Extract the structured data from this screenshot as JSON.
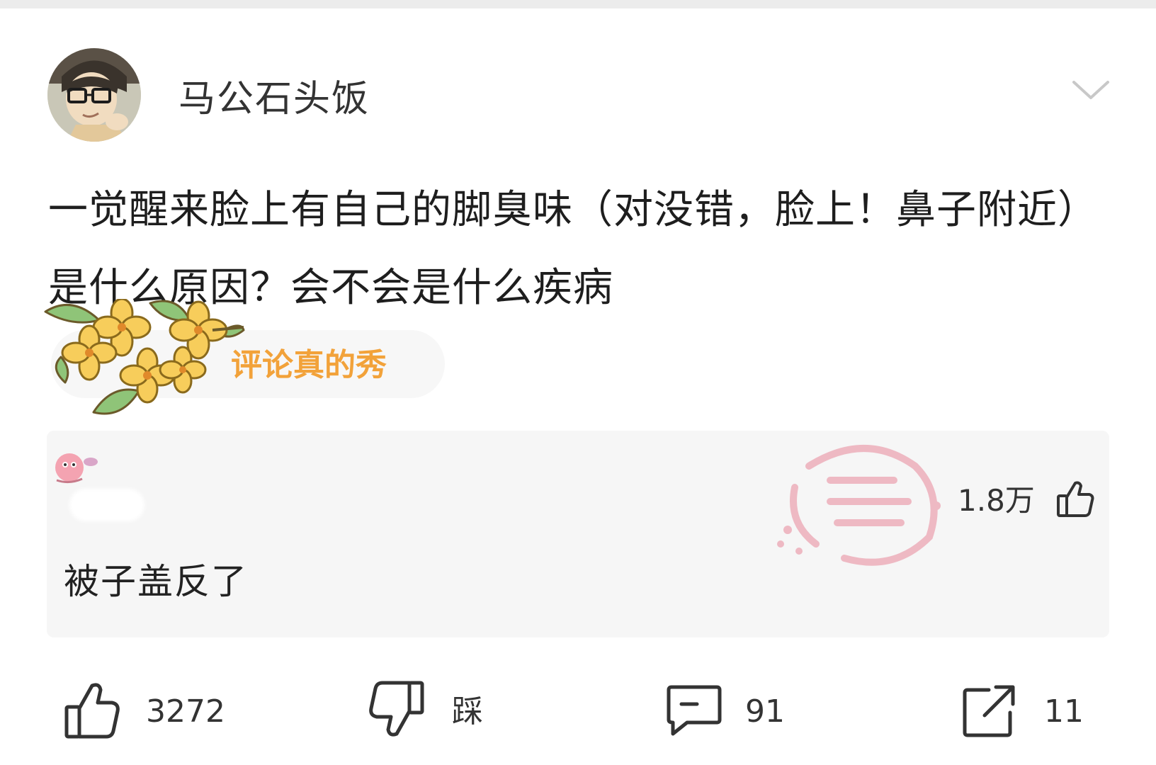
{
  "post": {
    "author_name": "马公石头饭",
    "text": "一觉醒来脸上有自己的脚臭味（对没错，脸上！鼻子附近）是什么原因？会不会是什么疾病",
    "tag_label": "评论真的秀"
  },
  "top_comment": {
    "text": "被子盖反了",
    "likes": "1.8万"
  },
  "actions": {
    "like_count": "3272",
    "dislike_label": "踩",
    "comment_count": "91",
    "share_count": "11"
  },
  "colors": {
    "tag_text": "#f2a23a",
    "stamp": "#e8899b",
    "card_bg": "#f6f6f6"
  },
  "icons": [
    "chevron-down-icon",
    "thumbs-up-icon",
    "thumbs-down-icon",
    "comment-icon",
    "share-icon",
    "flower-sticker",
    "watermark-stamp"
  ]
}
